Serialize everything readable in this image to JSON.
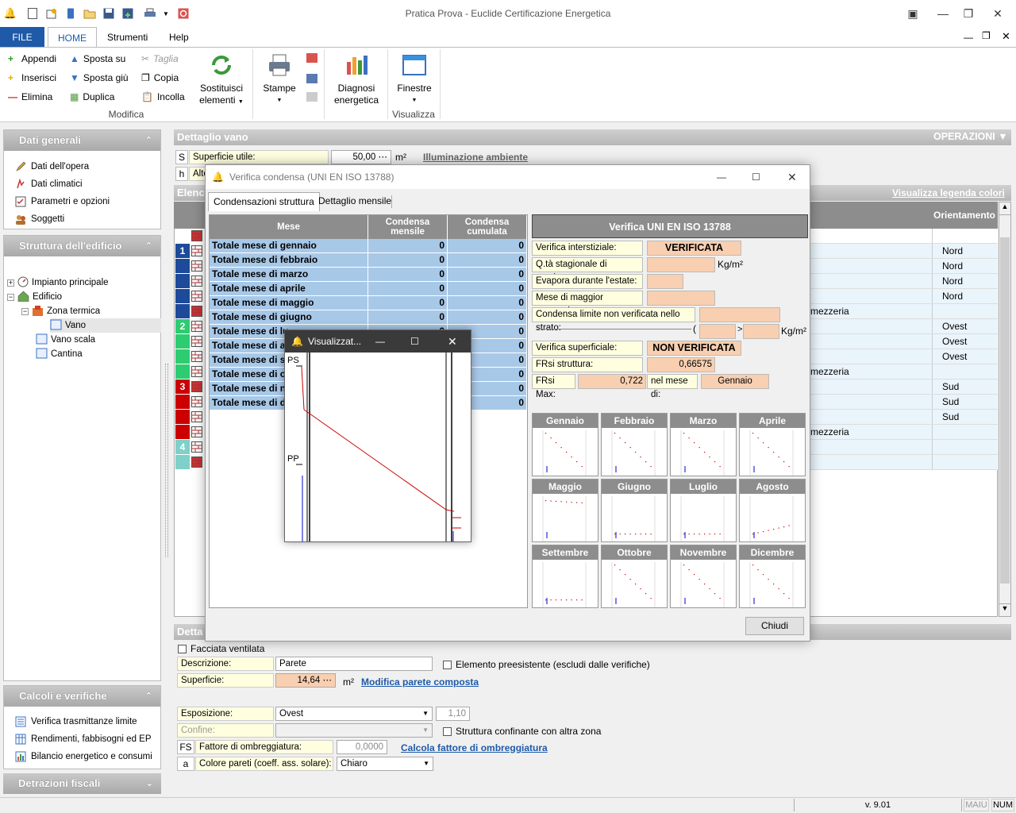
{
  "app": {
    "title": "Pratica Prova - Euclide Certificazione Energetica"
  },
  "menu": {
    "file": "FILE",
    "home": "HOME",
    "tools": "Strumenti",
    "help": "Help"
  },
  "ribbon": {
    "append": "Appendi",
    "insert": "Inserisci",
    "delete": "Elimina",
    "move_up": "Sposta su",
    "move_down": "Sposta giù",
    "duplicate": "Duplica",
    "cut": "Taglia",
    "copy": "Copia",
    "paste": "Incolla",
    "replace_line1": "Sostituisci",
    "replace_line2": "elementi",
    "print": "Stampe",
    "diag_line1": "Diagnosi",
    "diag_line2": "energetica",
    "windows": "Finestre",
    "group_modifica": "Modifica",
    "group_visualizza": "Visualizza"
  },
  "sidebar": {
    "general_title": "Dati generali",
    "general_items": [
      "Dati dell'opera",
      "Dati climatici",
      "Parametri e opzioni",
      "Soggetti"
    ],
    "structure_title": "Struttura dell'edificio",
    "tree": [
      "Impianto principale",
      "Edificio",
      "Zona termica",
      "Vano",
      "Vano scala",
      "Cantina"
    ],
    "calc_title": "Calcoli e verifiche",
    "calc_items": [
      "Verifica trasmittanze limite",
      "Rendimenti, fabbisogni ed EP",
      "Bilancio energetico e consumi"
    ],
    "tax_title": "Detrazioni fiscali"
  },
  "main": {
    "header": "Dettaglio vano",
    "operations": "OPERAZIONI",
    "s_code": "S",
    "s_label": "Superficie utile:",
    "s_value": "50,00",
    "s_unit": "m²",
    "s_link": "Illuminazione ambiente",
    "h_code": "h",
    "h_label": "Alte",
    "list_header": "Elenc",
    "legend_link": "Visualizza legenda colori",
    "col_orient": "Orientamento",
    "orient": [
      "",
      "Nord",
      "Nord",
      "Nord",
      "Nord",
      "mezzeria",
      "Ovest",
      "Ovest",
      "Ovest",
      "mezzeria",
      "Sud",
      "Sud",
      "Sud",
      "mezzeria",
      "",
      ""
    ],
    "row_nums": [
      "1",
      "2",
      "3",
      "4"
    ],
    "detail_header": "Detta"
  },
  "detail": {
    "ventilated": "Facciata ventilata",
    "desc_label": "Descrizione:",
    "desc_value": "Parete",
    "preexisting": "Elemento preesistente (escludi dalle verifiche)",
    "surf_label": "Superficie:",
    "surf_value": "14,64",
    "surf_unit": "m²",
    "surf_link": "Modifica parete composta",
    "expo_label": "Esposizione:",
    "expo_value": "Ovest",
    "expo_factor": "1,10",
    "boundary_label": "Confine:",
    "boundary_check": "Struttura confinante con altra zona",
    "fs_code": "FS",
    "fs_label": "Fattore di ombreggiatura:",
    "fs_value": "0,0000",
    "fs_link": "Calcola fattore di ombreggiatura",
    "a_code": "a",
    "a_label": "Colore pareti (coeff. ass. solare):",
    "a_value": "Chiaro"
  },
  "dialog": {
    "title": "Verifica condensa (UNI EN ISO 13788)",
    "tab1": "Condensazioni struttura",
    "tab2": "Dettaglio mensile",
    "col_month": "Mese",
    "col_monthly": "Condensa mensile",
    "col_cumul": "Condensa cumulata",
    "rows": [
      {
        "m": "Totale mese di gennaio",
        "a": "0",
        "b": "0"
      },
      {
        "m": "Totale mese di febbraio",
        "a": "0",
        "b": "0"
      },
      {
        "m": "Totale mese di marzo",
        "a": "0",
        "b": "0"
      },
      {
        "m": "Totale mese di aprile",
        "a": "0",
        "b": "0"
      },
      {
        "m": "Totale mese di maggio",
        "a": "0",
        "b": "0"
      },
      {
        "m": "Totale mese di giugno",
        "a": "0",
        "b": "0"
      },
      {
        "m": "Totale mese di lu",
        "a": "0",
        "b": "0"
      },
      {
        "m": "Totale mese di a",
        "a": "0",
        "b": "0"
      },
      {
        "m": "Totale mese di s",
        "a": "0",
        "b": "0"
      },
      {
        "m": "Totale mese di o",
        "a": "0",
        "b": "0"
      },
      {
        "m": "Totale mese di n",
        "a": "0",
        "b": "0"
      },
      {
        "m": "Totale mese di d",
        "a": "0",
        "b": "0"
      }
    ],
    "verif_title": "Verifica UNI EN ISO 13788",
    "interst_label": "Verifica interstiziale:",
    "interst_value": "VERIFICATA",
    "qta_label": "Q.tà stagionale di condensa:",
    "qta_unit": "Kg/m²",
    "evap_label": "Evapora durante l'estate:",
    "month_label": "Mese di maggior accumulo:",
    "limit_label": "Condensa limite non verificata nello strato:",
    "limit_unit": "Kg/m²",
    "sup_label": "Verifica superficiale:",
    "sup_value": "NON VERIFICATA",
    "frsi_label": "FRsi struttura:",
    "frsi_value": "0,66575",
    "frsimax_label": "FRsi Max:",
    "frsimax_value": "0,722",
    "month_of": "nel mese di:",
    "month_value": "Gennaio",
    "months": [
      "Gennaio",
      "Febbraio",
      "Marzo",
      "Aprile",
      "Maggio",
      "Giugno",
      "Luglio",
      "Agosto",
      "Settembre",
      "Ottobre",
      "Novembre",
      "Dicembre"
    ],
    "close": "Chiudi"
  },
  "popup": {
    "title": "Visualizzat...",
    "ps": "PS",
    "pp": "PP"
  },
  "status": {
    "version": "v. 9.01",
    "caps": "MAIU",
    "num": "NUM"
  },
  "colors": {
    "accent": "#1e5aa8",
    "row_blue": "#a8c8e8",
    "header_gray": "#8d8d8d",
    "field_yellow": "#ffffe0",
    "field_orange": "#f8cfb0"
  }
}
